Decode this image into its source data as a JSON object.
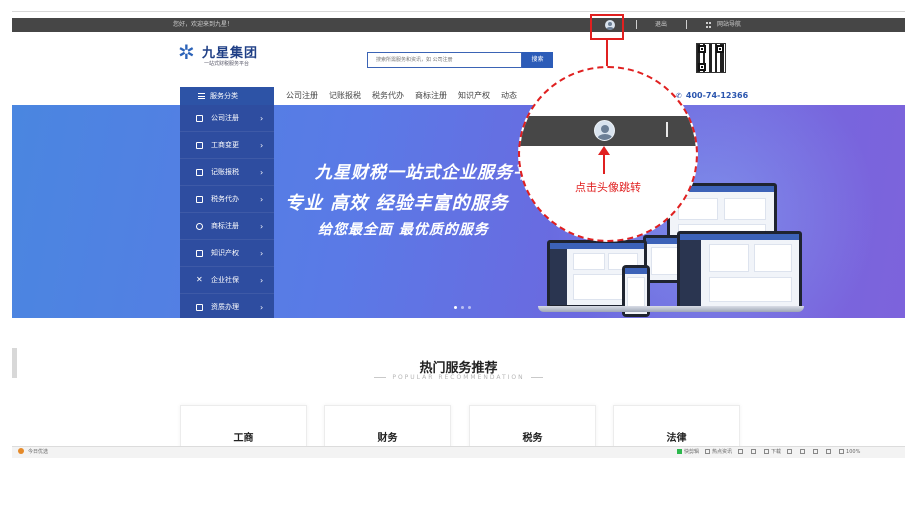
{
  "topbar": {
    "greeting": "您好，欢迎来到九星！",
    "logout": "退出",
    "site_nav": "网站导航"
  },
  "logo": {
    "name": "九星集团",
    "tagline": "一站式财税服务平台"
  },
  "search": {
    "placeholder": "搜索所需服务和资讯，如 公司注册",
    "button": "搜索"
  },
  "nav": {
    "category_label": "服务分类",
    "links": [
      "公司注册",
      "记账报税",
      "税务代办",
      "商标注册",
      "知识产权",
      "动态"
    ],
    "phone": "400-74-12366"
  },
  "sidebar": {
    "items": [
      {
        "label": "公司注册",
        "icon": "building-icon"
      },
      {
        "label": "工商变更",
        "icon": "document-icon"
      },
      {
        "label": "记账报税",
        "icon": "ledger-icon"
      },
      {
        "label": "税务代办",
        "icon": "tax-icon"
      },
      {
        "label": "商标注册",
        "icon": "trademark-icon"
      },
      {
        "label": "知识产权",
        "icon": "patent-icon"
      },
      {
        "label": "企业社保",
        "icon": "insurance-icon"
      },
      {
        "label": "资质办理",
        "icon": "certificate-icon"
      }
    ]
  },
  "banner": {
    "line1": "九星财税一站式企业服务平",
    "line2": "专业  高效  经验丰富的服务",
    "line3": "给您最全面  最优质的服务"
  },
  "hot": {
    "title": "热门服务推荐",
    "subtitle": "POPULAR RECOMMENDATION",
    "cards": [
      "工商",
      "财务",
      "税务",
      "法律"
    ]
  },
  "statusbar": {
    "left": "今日优选",
    "right": [
      "快剪辑",
      "热点资讯",
      "下载",
      "100%"
    ]
  },
  "annotation": {
    "caption": "点击头像跳转",
    "color": "#e02020"
  },
  "colors": {
    "brand_blue": "#2d53a6",
    "topbar": "#464646"
  }
}
